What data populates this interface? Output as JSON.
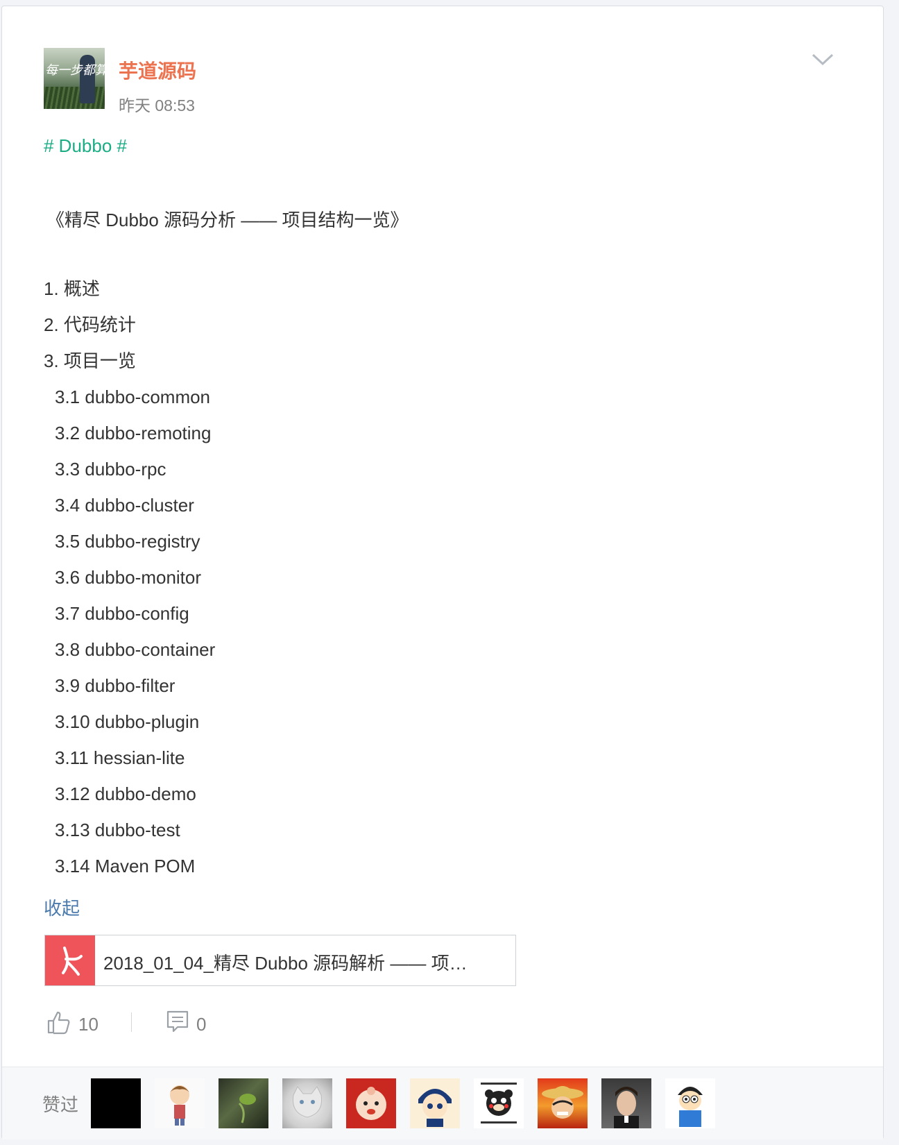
{
  "post": {
    "author": "芋道源码",
    "time": "昨天 08:53",
    "avatar_overlay_text": "每一步都算数",
    "tag": "# Dubbo #",
    "title": "《精尽 Dubbo 源码分析 —— 项目结构一览》",
    "toc": [
      {
        "text": "1. 概述",
        "level": 1
      },
      {
        "text": "2. 代码统计",
        "level": 1
      },
      {
        "text": "3. 项目一览",
        "level": 1
      },
      {
        "text": "3.1 dubbo-common",
        "level": 2
      },
      {
        "text": "3.2 dubbo-remoting",
        "level": 2
      },
      {
        "text": "3.3 dubbo-rpc",
        "level": 2
      },
      {
        "text": "3.4 dubbo-cluster",
        "level": 2
      },
      {
        "text": "3.5 dubbo-registry",
        "level": 2
      },
      {
        "text": "3.6 dubbo-monitor",
        "level": 2
      },
      {
        "text": "3.7 dubbo-config",
        "level": 2
      },
      {
        "text": "3.8 dubbo-container",
        "level": 2
      },
      {
        "text": "3.9 dubbo-filter",
        "level": 2
      },
      {
        "text": "3.10 dubbo-plugin",
        "level": 2
      },
      {
        "text": "3.11 hessian-lite",
        "level": 2
      },
      {
        "text": "3.12 dubbo-demo",
        "level": 2
      },
      {
        "text": "3.13 dubbo-test",
        "level": 2
      },
      {
        "text": "3.14 Maven POM",
        "level": 2
      }
    ],
    "collapse_label": "收起",
    "attachment": {
      "name": "2018_01_04_精尽 Dubbo 源码解析 —— 项…",
      "icon": "pdf-icon"
    },
    "likes": "10",
    "comments": "0"
  },
  "liked_by": {
    "label": "赞过",
    "avatars": [
      "avatar-black",
      "avatar-cartoon-boy",
      "avatar-frog",
      "avatar-kitten",
      "avatar-cartoon-baby",
      "avatar-cartoon-face",
      "avatar-kumamon",
      "avatar-luffy",
      "avatar-man-portrait",
      "avatar-cartoon-blue"
    ]
  },
  "colors": {
    "author": "#eb7350",
    "tag": "#1aad85",
    "link": "#4b7aad",
    "pdf": "#ef545b",
    "text": "#333333",
    "muted": "#808080"
  }
}
